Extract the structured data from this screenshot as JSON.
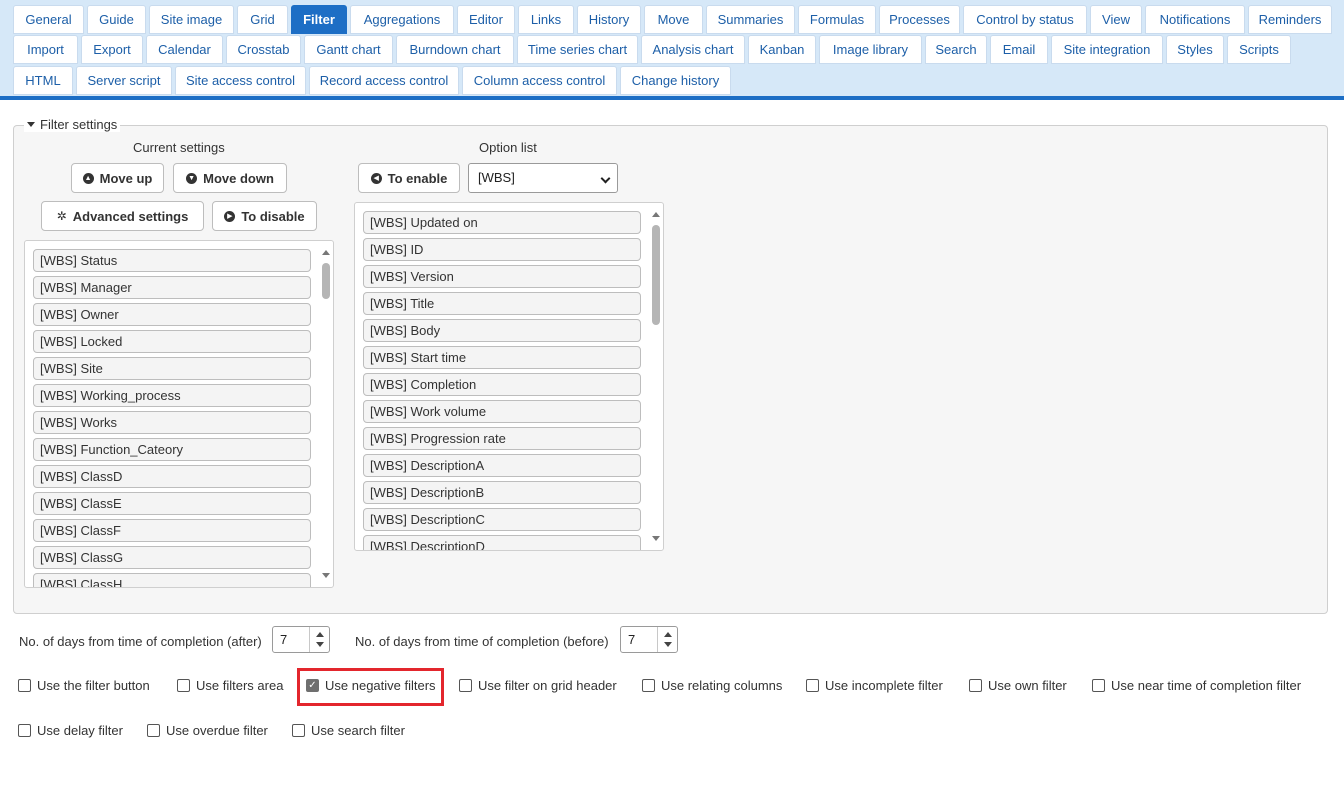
{
  "tabs": [
    {
      "label": "General",
      "active": false
    },
    {
      "label": "Guide",
      "active": false
    },
    {
      "label": "Site image",
      "active": false
    },
    {
      "label": "Grid",
      "active": false
    },
    {
      "label": "Filter",
      "active": true
    },
    {
      "label": "Aggregations",
      "active": false
    },
    {
      "label": "Editor",
      "active": false
    },
    {
      "label": "Links",
      "active": false
    },
    {
      "label": "History",
      "active": false
    },
    {
      "label": "Move",
      "active": false
    },
    {
      "label": "Summaries",
      "active": false
    },
    {
      "label": "Formulas",
      "active": false
    },
    {
      "label": "Processes",
      "active": false
    },
    {
      "label": "Control by status",
      "active": false
    },
    {
      "label": "View",
      "active": false
    },
    {
      "label": "Notifications",
      "active": false
    },
    {
      "label": "Reminders",
      "active": false
    },
    {
      "label": "Import",
      "active": false
    },
    {
      "label": "Export",
      "active": false
    },
    {
      "label": "Calendar",
      "active": false
    },
    {
      "label": "Crosstab",
      "active": false
    },
    {
      "label": "Gantt chart",
      "active": false
    },
    {
      "label": "Burndown chart",
      "active": false
    },
    {
      "label": "Time series chart",
      "active": false
    },
    {
      "label": "Analysis chart",
      "active": false
    },
    {
      "label": "Kanban",
      "active": false
    },
    {
      "label": "Image library",
      "active": false
    },
    {
      "label": "Search",
      "active": false
    },
    {
      "label": "Email",
      "active": false
    },
    {
      "label": "Site integration",
      "active": false
    },
    {
      "label": "Styles",
      "active": false
    },
    {
      "label": "Scripts",
      "active": false
    },
    {
      "label": "HTML",
      "active": false
    },
    {
      "label": "Server script",
      "active": false
    },
    {
      "label": "Site access control",
      "active": false
    },
    {
      "label": "Record access control",
      "active": false
    },
    {
      "label": "Column access control",
      "active": false
    },
    {
      "label": "Change history",
      "active": false
    }
  ],
  "filter_settings": {
    "legend": "Filter settings",
    "current": {
      "title": "Current settings",
      "move_up": "Move up",
      "move_down": "Move down",
      "advanced": "Advanced settings",
      "to_disable": "To disable",
      "items": [
        "[WBS] Status",
        "[WBS] Manager",
        "[WBS] Owner",
        "[WBS] Locked",
        "[WBS] Site",
        "[WBS] Working_process",
        "[WBS] Works",
        "[WBS] Function_Cateory",
        "[WBS] ClassD",
        "[WBS] ClassE",
        "[WBS] ClassF",
        "[WBS] ClassG",
        "[WBS] ClassH"
      ]
    },
    "options": {
      "title": "Option list",
      "to_enable": "To enable",
      "selected": "[WBS]",
      "items": [
        "[WBS] Updated on",
        "[WBS] ID",
        "[WBS] Version",
        "[WBS] Title",
        "[WBS] Body",
        "[WBS] Start time",
        "[WBS] Completion",
        "[WBS] Work volume",
        "[WBS] Progression rate",
        "[WBS] DescriptionA",
        "[WBS] DescriptionB",
        "[WBS] DescriptionC",
        "[WBS] DescriptionD"
      ]
    }
  },
  "days_after": {
    "label": "No. of days from time of completion (after)",
    "value": "7"
  },
  "days_before": {
    "label": "No. of days from time of completion (before)",
    "value": "7"
  },
  "checkboxes": [
    {
      "label": "Use the filter button",
      "checked": false
    },
    {
      "label": "Use filters area",
      "checked": false
    },
    {
      "label": "Use negative filters",
      "checked": true
    },
    {
      "label": "Use filter on grid header",
      "checked": false
    },
    {
      "label": "Use relating columns",
      "checked": false
    },
    {
      "label": "Use incomplete filter",
      "checked": false
    },
    {
      "label": "Use own filter",
      "checked": false
    },
    {
      "label": "Use near time of completion filter",
      "checked": false
    },
    {
      "label": "Use delay filter",
      "checked": false
    },
    {
      "label": "Use overdue filter",
      "checked": false
    },
    {
      "label": "Use search filter",
      "checked": false
    }
  ],
  "colors": {
    "accent": "#1d6ec5",
    "highlight": "#e3262d",
    "tabbar": "#d6e8f8"
  }
}
